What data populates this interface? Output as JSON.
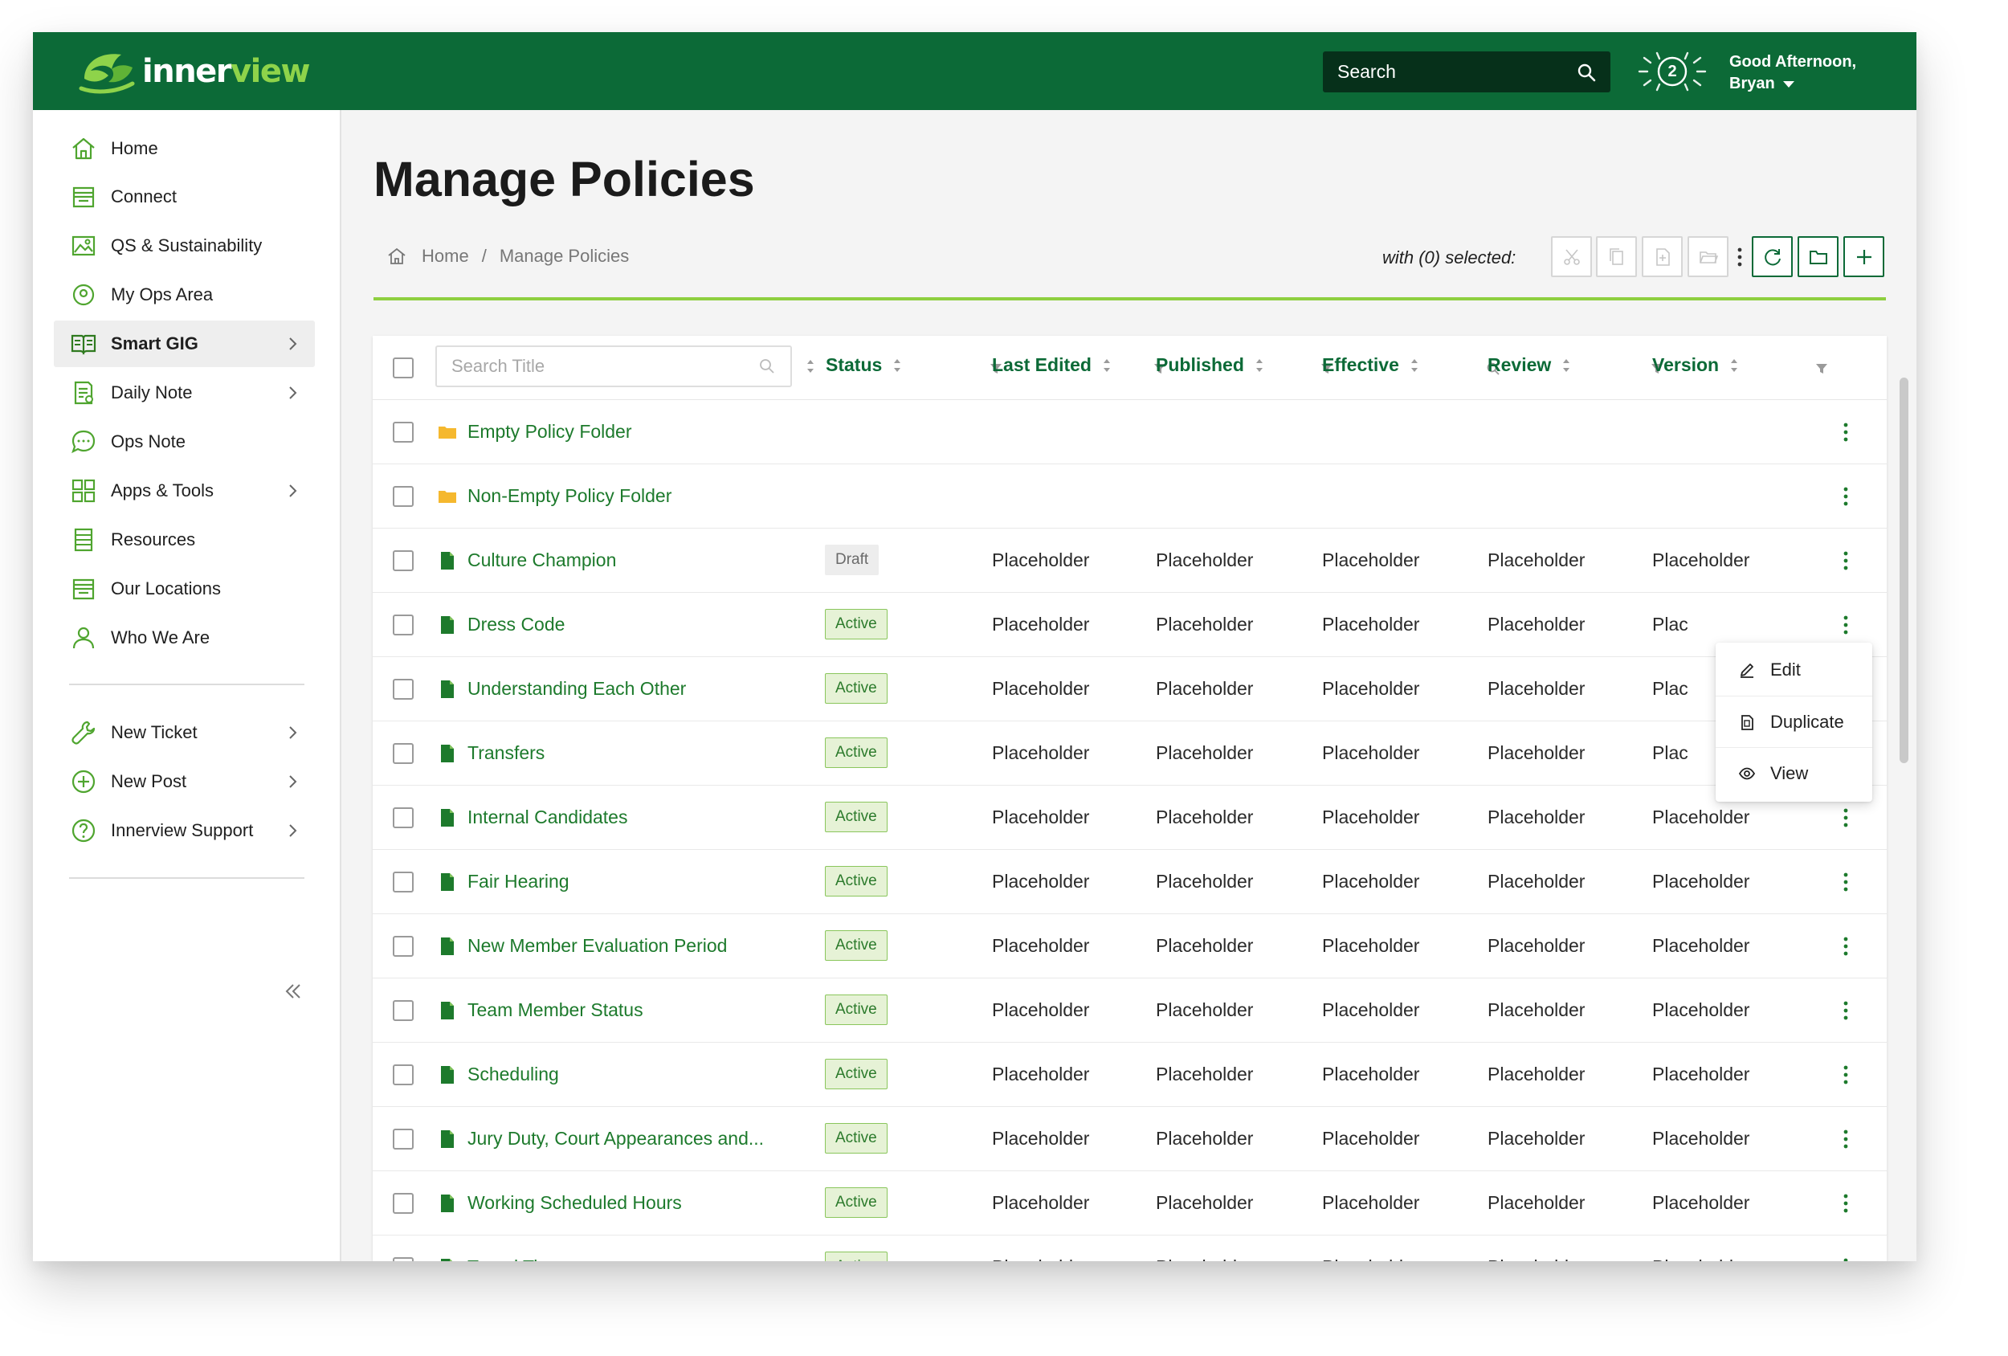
{
  "header": {
    "logo_inner": "inner",
    "logo_view": "view",
    "search_placeholder": "Search",
    "notification_count": "2",
    "greeting_line1": "Good Afternoon,",
    "greeting_line2": "Bryan"
  },
  "sidebar": {
    "items": [
      {
        "label": "Home",
        "icon": "home-icon"
      },
      {
        "label": "Connect",
        "icon": "storefront-icon"
      },
      {
        "label": "QS & Sustainability",
        "icon": "image-icon"
      },
      {
        "label": "My Ops Area",
        "icon": "map-pin-icon"
      },
      {
        "label": "Smart GIG",
        "icon": "book-icon",
        "active": true
      },
      {
        "label": "Daily Note",
        "icon": "note-icon"
      },
      {
        "label": "Ops Note",
        "icon": "chat-bubble-icon"
      },
      {
        "label": "Apps & Tools",
        "icon": "grid-icon"
      },
      {
        "label": "Resources",
        "icon": "list-doc-icon"
      },
      {
        "label": "Our Locations",
        "icon": "storefront-icon"
      },
      {
        "label": "Who We Are",
        "icon": "person-icon"
      }
    ],
    "secondary": [
      {
        "label": "New Ticket",
        "icon": "wrench-icon"
      },
      {
        "label": "New Post",
        "icon": "plus-circle-icon"
      },
      {
        "label": "Innerview Support",
        "icon": "question-circle-icon"
      }
    ]
  },
  "page": {
    "title": "Manage Policies",
    "breadcrumb_home": "Home",
    "breadcrumb_sep": "/",
    "breadcrumb_current": "Manage Policies",
    "with_selected": "with (0) selected:"
  },
  "table": {
    "search_placeholder": "Search Title",
    "columns": [
      "Status",
      "Last Edited",
      "Published",
      "Effective",
      "Review",
      "Version"
    ],
    "rows": [
      {
        "type": "folder",
        "title": "Empty Policy Folder"
      },
      {
        "type": "folder",
        "title": "Non-Empty Policy Folder"
      },
      {
        "type": "doc",
        "title": "Culture Champion",
        "status": "Draft",
        "cells": [
          "Placeholder",
          "Placeholder",
          "Placeholder",
          "Placeholder",
          "Placeholder"
        ]
      },
      {
        "type": "doc",
        "title": "Dress Code",
        "status": "Active",
        "cells": [
          "Placeholder",
          "Placeholder",
          "Placeholder",
          "Placeholder",
          "Plac"
        ]
      },
      {
        "type": "doc",
        "title": "Understanding Each Other",
        "status": "Active",
        "cells": [
          "Placeholder",
          "Placeholder",
          "Placeholder",
          "Placeholder",
          "Plac"
        ]
      },
      {
        "type": "doc",
        "title": "Transfers",
        "status": "Active",
        "cells": [
          "Placeholder",
          "Placeholder",
          "Placeholder",
          "Placeholder",
          "Plac"
        ]
      },
      {
        "type": "doc",
        "title": "Internal Candidates",
        "status": "Active",
        "cells": [
          "Placeholder",
          "Placeholder",
          "Placeholder",
          "Placeholder",
          "Placeholder"
        ]
      },
      {
        "type": "doc",
        "title": "Fair Hearing",
        "status": "Active",
        "cells": [
          "Placeholder",
          "Placeholder",
          "Placeholder",
          "Placeholder",
          "Placeholder"
        ]
      },
      {
        "type": "doc",
        "title": "New Member Evaluation Period",
        "status": "Active",
        "cells": [
          "Placeholder",
          "Placeholder",
          "Placeholder",
          "Placeholder",
          "Placeholder"
        ]
      },
      {
        "type": "doc",
        "title": "Team Member Status",
        "status": "Active",
        "cells": [
          "Placeholder",
          "Placeholder",
          "Placeholder",
          "Placeholder",
          "Placeholder"
        ]
      },
      {
        "type": "doc",
        "title": "Scheduling",
        "status": "Active",
        "cells": [
          "Placeholder",
          "Placeholder",
          "Placeholder",
          "Placeholder",
          "Placeholder"
        ]
      },
      {
        "type": "doc",
        "title": "Jury Duty, Court Appearances and...",
        "status": "Active",
        "cells": [
          "Placeholder",
          "Placeholder",
          "Placeholder",
          "Placeholder",
          "Placeholder"
        ]
      },
      {
        "type": "doc",
        "title": "Working Scheduled Hours",
        "status": "Active",
        "cells": [
          "Placeholder",
          "Placeholder",
          "Placeholder",
          "Placeholder",
          "Placeholder"
        ]
      },
      {
        "type": "doc",
        "title": "Travel Time",
        "status": "Active",
        "cells": [
          "Placeholder",
          "Placeholder",
          "Placeholder",
          "Placeholder",
          "Placeholder"
        ]
      }
    ]
  },
  "context_menu": {
    "items": [
      {
        "label": "Edit",
        "icon": "pencil-icon"
      },
      {
        "label": "Duplicate",
        "icon": "duplicate-icon"
      },
      {
        "label": "View",
        "icon": "eye-icon"
      }
    ]
  },
  "colors": {
    "brand_green": "#0c6a37",
    "accent_green": "#8ecf3f",
    "link_green": "#1d7a2c",
    "folder_yellow": "#f5b82e"
  }
}
